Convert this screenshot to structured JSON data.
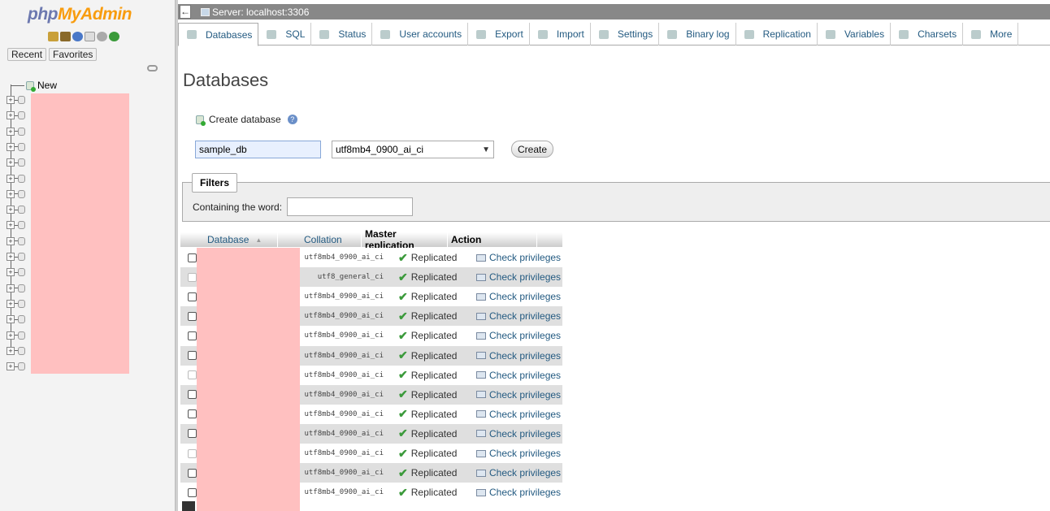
{
  "nav": {
    "logo_php": "php",
    "logo_myadmin": "MyAdmin",
    "tabs": [
      "Recent",
      "Favorites"
    ],
    "tree_new_label": "New",
    "tree_db_count": 18
  },
  "topbar": {
    "server_label": "Server: localhost:3306"
  },
  "menu": {
    "tabs": [
      {
        "label": "Databases",
        "icon": "database-icon",
        "active": true
      },
      {
        "label": "SQL",
        "icon": "sql-icon"
      },
      {
        "label": "Status",
        "icon": "status-icon"
      },
      {
        "label": "User accounts",
        "icon": "users-icon"
      },
      {
        "label": "Export",
        "icon": "export-icon"
      },
      {
        "label": "Import",
        "icon": "import-icon"
      },
      {
        "label": "Settings",
        "icon": "wrench-icon"
      },
      {
        "label": "Binary log",
        "icon": "binlog-icon"
      },
      {
        "label": "Replication",
        "icon": "replication-icon"
      },
      {
        "label": "Variables",
        "icon": "variables-icon"
      },
      {
        "label": "Charsets",
        "icon": "charsets-icon"
      },
      {
        "label": "More",
        "icon": "triangle-down-icon"
      }
    ]
  },
  "main": {
    "title": "Databases",
    "create_label": "Create database",
    "db_name_value": "sample_db",
    "collation_value": "utf8mb4_0900_ai_ci",
    "create_button": "Create",
    "filters_legend": "Filters",
    "containing_label": "Containing the word:",
    "filter_value": ""
  },
  "table": {
    "headers": {
      "database": "Database",
      "collation": "Collation",
      "replication": "Master replication",
      "action": "Action"
    },
    "rows": [
      {
        "collation": "utf8mb4_0900_ai_ci",
        "replication": "Replicated",
        "action": "Check privileges",
        "checkbox_enabled": true
      },
      {
        "collation": "utf8_general_ci",
        "replication": "Replicated",
        "action": "Check privileges",
        "checkbox_enabled": false
      },
      {
        "collation": "utf8mb4_0900_ai_ci",
        "replication": "Replicated",
        "action": "Check privileges",
        "checkbox_enabled": true
      },
      {
        "collation": "utf8mb4_0900_ai_ci",
        "replication": "Replicated",
        "action": "Check privileges",
        "checkbox_enabled": true
      },
      {
        "collation": "utf8mb4_0900_ai_ci",
        "replication": "Replicated",
        "action": "Check privileges",
        "checkbox_enabled": true
      },
      {
        "collation": "utf8mb4_0900_ai_ci",
        "replication": "Replicated",
        "action": "Check privileges",
        "checkbox_enabled": true
      },
      {
        "collation": "utf8mb4_0900_ai_ci",
        "replication": "Replicated",
        "action": "Check privileges",
        "checkbox_enabled": false
      },
      {
        "collation": "utf8mb4_0900_ai_ci",
        "replication": "Replicated",
        "action": "Check privileges",
        "checkbox_enabled": true
      },
      {
        "collation": "utf8mb4_0900_ai_ci",
        "replication": "Replicated",
        "action": "Check privileges",
        "checkbox_enabled": true
      },
      {
        "collation": "utf8mb4_0900_ai_ci",
        "replication": "Replicated",
        "action": "Check privileges",
        "checkbox_enabled": true
      },
      {
        "collation": "utf8mb4_0900_ai_ci",
        "replication": "Replicated",
        "action": "Check privileges",
        "checkbox_enabled": false
      },
      {
        "collation": "utf8mb4_0900_ai_ci",
        "replication": "Replicated",
        "action": "Check privileges",
        "checkbox_enabled": true
      },
      {
        "collation": "utf8mb4_0900_ai_ci",
        "replication": "Replicated",
        "action": "Check privileges",
        "checkbox_enabled": true
      }
    ]
  },
  "colors": {
    "link": "#235a81",
    "logo_php": "#6c78af",
    "logo_myadmin": "#f89c0e",
    "replicated_check": "#3b9a3b",
    "redaction": "#ffc0c0"
  }
}
